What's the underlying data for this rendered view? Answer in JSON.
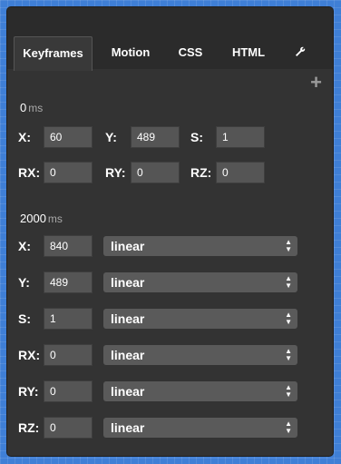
{
  "tabs": [
    {
      "label": "Keyframes",
      "active": true
    },
    {
      "label": "Motion"
    },
    {
      "label": "CSS"
    },
    {
      "label": "HTML"
    }
  ],
  "settings_icon": "wrench-icon",
  "add_icon": "plus-icon",
  "keyframe0": {
    "time": "0",
    "unit": "ms",
    "x_label": "X:",
    "x_value": "60",
    "y_label": "Y:",
    "y_value": "489",
    "s_label": "S:",
    "s_value": "1",
    "rx_label": "RX:",
    "rx_value": "0",
    "ry_label": "RY:",
    "ry_value": "0",
    "rz_label": "RZ:",
    "rz_value": "0"
  },
  "keyframe1": {
    "time": "2000",
    "unit": "ms",
    "rows": [
      {
        "label": "X:",
        "value": "840",
        "easing": "linear"
      },
      {
        "label": "Y:",
        "value": "489",
        "easing": "linear"
      },
      {
        "label": "S:",
        "value": "1",
        "easing": "linear"
      },
      {
        "label": "RX:",
        "value": "0",
        "easing": "linear"
      },
      {
        "label": "RY:",
        "value": "0",
        "easing": "linear"
      },
      {
        "label": "RZ:",
        "value": "0",
        "easing": "linear"
      }
    ]
  }
}
